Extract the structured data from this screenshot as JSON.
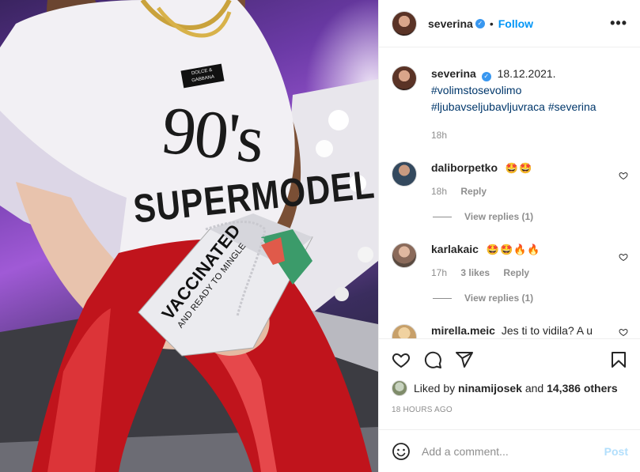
{
  "media": {
    "shirt_number": "90's",
    "shirt_word": "SUPERMODEL",
    "shirt_label": "DOLCE & GABBANA",
    "bag_big": "VACCINATED",
    "bag_small": "AND READY TO MINGLE"
  },
  "header": {
    "username": "severina",
    "separator": "•",
    "follow_label": "Follow",
    "more_label": "•••",
    "icons": {
      "verified": "verified-badge-icon",
      "more": "more-options-icon"
    }
  },
  "caption": {
    "username": "severina",
    "date": "18.12.2021.",
    "hashtags": [
      "#volimstosevolimo",
      "#ljubavseljubavljuvraca",
      "#severina"
    ],
    "time": "18h"
  },
  "comments": [
    {
      "username": "daliborpetko",
      "text": "🤩🤩",
      "time": "18h",
      "likes": "",
      "reply_label": "Reply",
      "view_replies": "View replies (1)"
    },
    {
      "username": "karlakaic",
      "text": "🤩🤩🔥🔥",
      "time": "17h",
      "likes": "3 likes",
      "reply_label": "Reply",
      "view_replies": "View replies (1)"
    },
    {
      "username": "mirella.meic",
      "text": "Jes ti to vidila? A u"
    }
  ],
  "actions": {
    "icons": [
      "heart-icon",
      "comment-icon",
      "share-icon",
      "bookmark-icon"
    ]
  },
  "likes": {
    "prefix": "Liked by",
    "user": "ninamijosek",
    "and": "and",
    "others": "14,386 others"
  },
  "time_ago": "18 HOURS AGO",
  "add_comment": {
    "placeholder": "Add a comment...",
    "post_label": "Post"
  },
  "colors": {
    "accent": "#0095f6",
    "link": "#00376b",
    "muted": "#8e8e8e",
    "post_disabled": "#b2dffc",
    "verified": "#3897f0"
  }
}
